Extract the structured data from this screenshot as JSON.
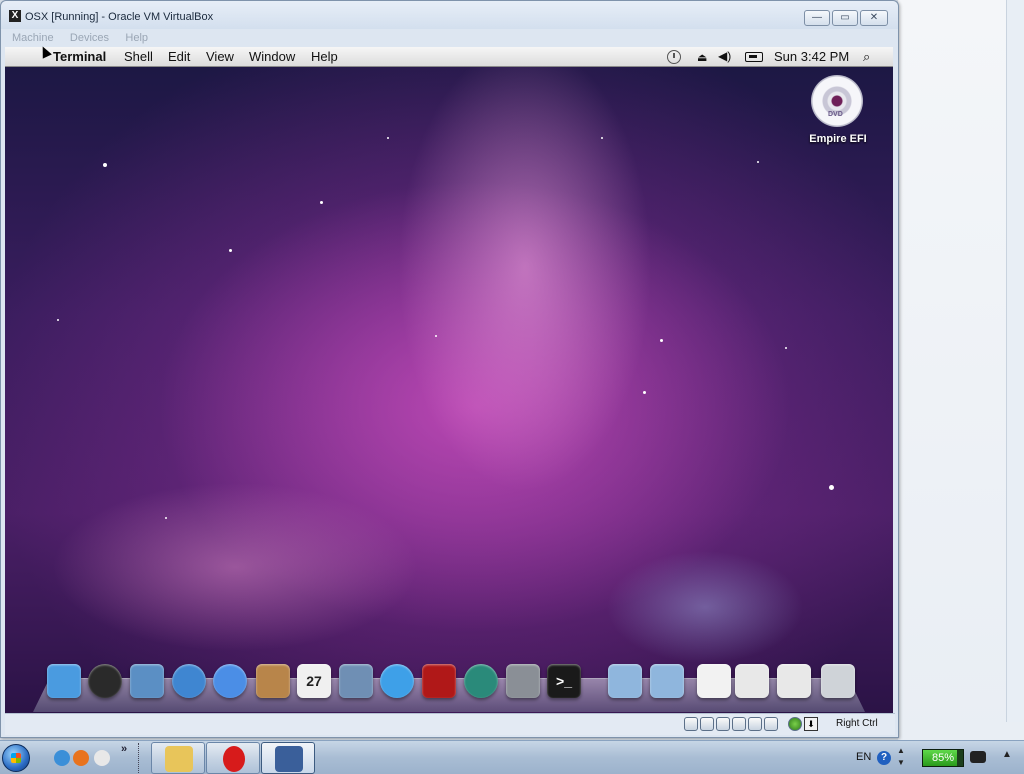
{
  "window": {
    "title": "OSX [Running] - Oracle VM VirtualBox",
    "app_icon": "X",
    "minimize_label": "—",
    "restore_label": "▭",
    "close_label": "✕"
  },
  "vbox_menu": [
    "Machine",
    "Devices",
    "Help"
  ],
  "guest_menubar": {
    "apple_icon": "apple-icon",
    "active_app": "Terminal",
    "items": [
      "Shell",
      "Edit",
      "View",
      "Window",
      "Help"
    ],
    "clock": "Sun 3:42 PM"
  },
  "desktop": {
    "volume_label": "Empire EFI",
    "volume_icon": "dvd-icon",
    "dvd_text": "DVD"
  },
  "dock": {
    "items": [
      {
        "name": "Finder",
        "icon": "finder-icon",
        "color": "#4a9be0"
      },
      {
        "name": "Dashboard",
        "icon": "dashboard-icon",
        "color": "#2a2a2a"
      },
      {
        "name": "Mail",
        "icon": "mail-icon",
        "color": "#5b8fc4"
      },
      {
        "name": "Safari",
        "icon": "safari-icon",
        "color": "#3f86d1"
      },
      {
        "name": "iChat",
        "icon": "ichat-icon",
        "color": "#4b8ee6"
      },
      {
        "name": "Address Book",
        "icon": "address-book-icon",
        "color": "#b8854a"
      },
      {
        "name": "iCal",
        "icon": "ical-icon",
        "color": "#f0f0f0",
        "glyph": "27"
      },
      {
        "name": "iPhoto",
        "icon": "iphoto-icon",
        "color": "#6f8fb4"
      },
      {
        "name": "iTunes",
        "icon": "itunes-icon",
        "color": "#3ea0e8"
      },
      {
        "name": "Front Row",
        "icon": "front-row-icon",
        "color": "#b01818"
      },
      {
        "name": "Time Machine",
        "icon": "time-machine-icon",
        "color": "#2a8a7a"
      },
      {
        "name": "System Preferences",
        "icon": "system-preferences-icon",
        "color": "#8a8f96"
      },
      {
        "name": "Terminal",
        "icon": "terminal-icon",
        "color": "#1a1a1a",
        "glyph": ">_"
      },
      {
        "name": "Applications",
        "icon": "applications-folder-icon",
        "color": "#8fb6dd"
      },
      {
        "name": "Documents",
        "icon": "documents-folder-icon",
        "color": "#8fb6dd"
      },
      {
        "name": "Downloads stack",
        "icon": "downloads-stack-icon",
        "color": "#f2f2f2"
      },
      {
        "name": "Screenshot 1",
        "icon": "screenshot-icon",
        "color": "#e8e8e8"
      },
      {
        "name": "Screenshot 2",
        "icon": "screenshot-icon",
        "color": "#e8e8e8"
      },
      {
        "name": "Trash",
        "icon": "trash-icon",
        "color": "#cfd3d8"
      }
    ]
  },
  "statusbar": {
    "host_key": "Right Ctrl"
  },
  "taskbar": {
    "quick_launch": [
      {
        "icon": "internet-explorer-icon",
        "color": "#3b8fd8"
      },
      {
        "icon": "firefox-icon",
        "color": "#e8731e"
      },
      {
        "icon": "chat-icon",
        "color": "#e8e8e8"
      }
    ],
    "more": "»",
    "buttons": [
      {
        "icon": "file-explorer-icon",
        "color": "#e8c55a"
      },
      {
        "icon": "opera-icon",
        "color": "#d71b1b"
      },
      {
        "icon": "virtualbox-icon",
        "color": "#3a5f9a"
      }
    ],
    "tray": {
      "language": "EN",
      "help_icon": "?",
      "battery_percent": "85%",
      "show_desktop": "▲"
    }
  }
}
